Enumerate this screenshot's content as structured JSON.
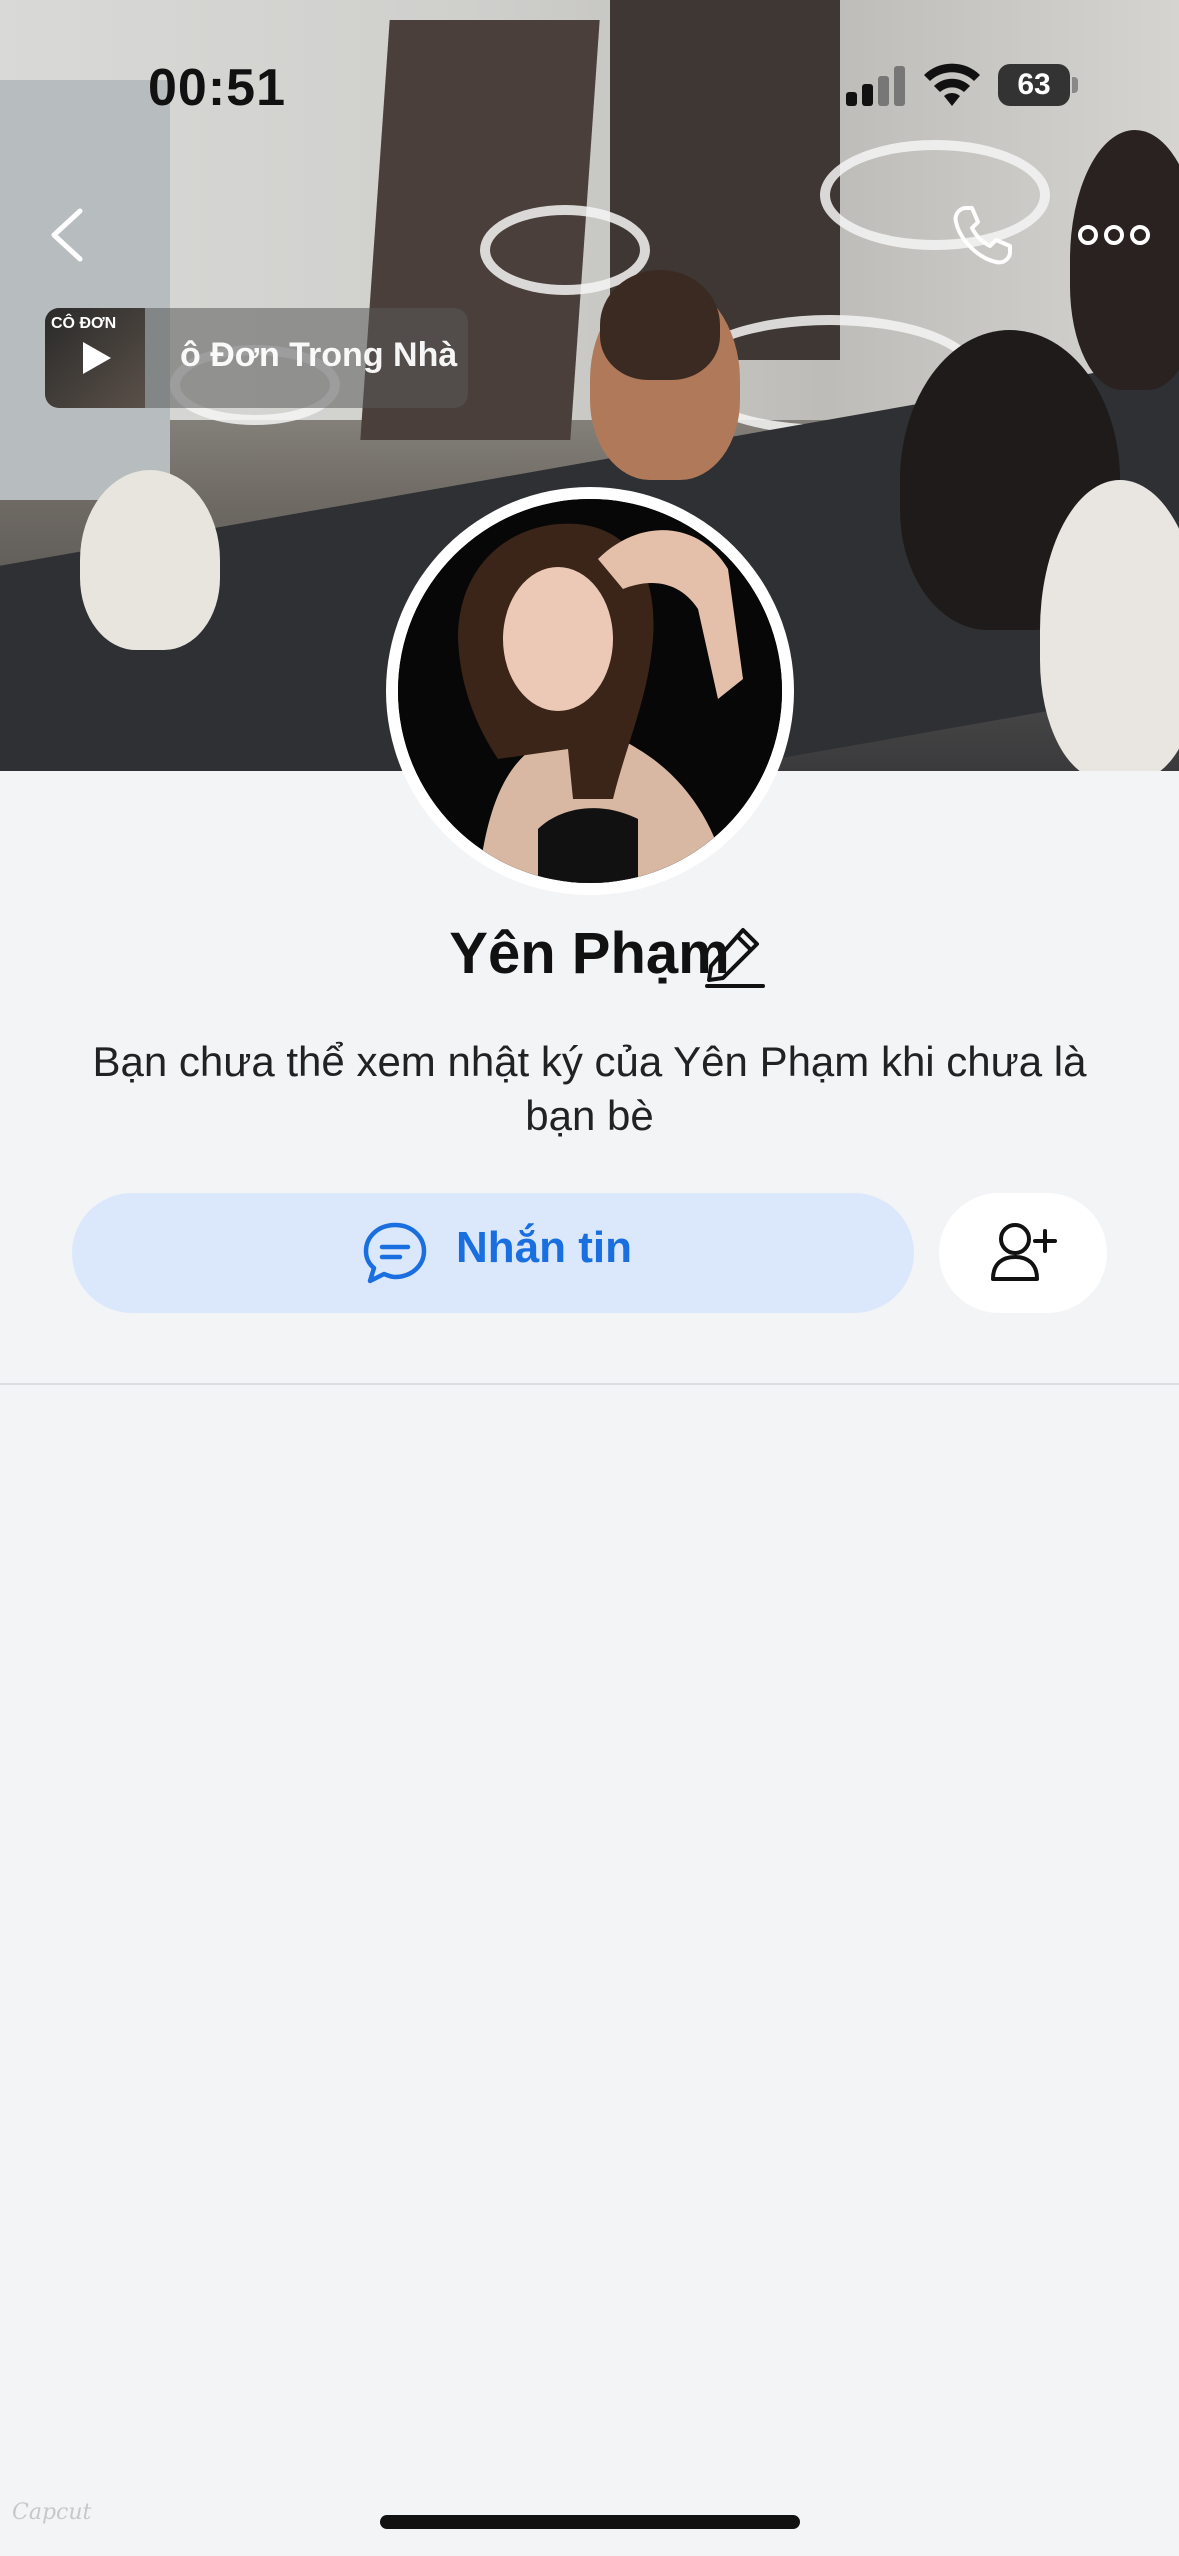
{
  "status_bar": {
    "time": "00:51",
    "battery": "63"
  },
  "music": {
    "thumb_text": "CÔ ĐƠN",
    "title": "ô Đơn Trong Nhà"
  },
  "profile": {
    "name": "Yên Phạm",
    "notice": "Bạn chưa thể xem nhật ký của Yên Phạm khi chưa là bạn bè"
  },
  "actions": {
    "message_label": "Nhắn tin"
  },
  "watermark": "Capcut",
  "colors": {
    "accent": "#1a6fe0",
    "message_bg": "#dbe8fb",
    "page_bg": "#f3f4f6"
  },
  "icons": {
    "back": "chevron-left-icon",
    "call": "phone-icon",
    "more": "more-dots-icon",
    "play": "play-icon",
    "edit": "pencil-icon",
    "message": "chat-bubble-icon",
    "add_friend": "add-user-icon"
  }
}
